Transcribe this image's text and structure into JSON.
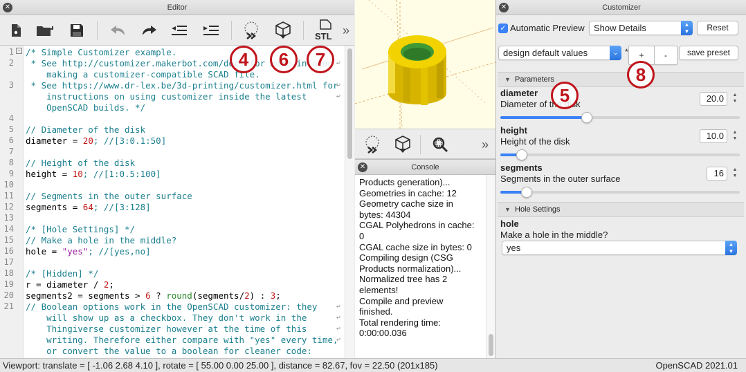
{
  "editor": {
    "title": "Editor",
    "toolbar_more": "»",
    "stl_label": "STL",
    "lines": [
      {
        "n": "1",
        "segs": [
          {
            "t": "/* Simple Customizer example.",
            "c": "#1a7f8e"
          }
        ]
      },
      {
        "n": "2",
        "segs": [
          {
            "t": " * See http://customizer.makerbot.com/docs for more info on",
            "c": "#1a7f8e"
          }
        ]
      },
      {
        "n": "",
        "segs": [
          {
            "t": "    making a customizer-compatible SCAD file.",
            "c": "#1a7f8e"
          }
        ]
      },
      {
        "n": "3",
        "segs": [
          {
            "t": " * See https://www.dr-lex.be/3d-printing/customizer.html for",
            "c": "#1a7f8e"
          }
        ]
      },
      {
        "n": "",
        "segs": [
          {
            "t": "    instructions on using customizer inside the latest",
            "c": "#1a7f8e"
          }
        ]
      },
      {
        "n": "",
        "segs": [
          {
            "t": "    OpenSCAD builds. */",
            "c": "#1a7f8e"
          }
        ]
      },
      {
        "n": "4",
        "segs": []
      },
      {
        "n": "5",
        "segs": [
          {
            "t": "// Diameter of the disk",
            "c": "#1a7f8e"
          }
        ]
      },
      {
        "n": "6",
        "segs": [
          {
            "t": "diameter = ",
            "c": "#000"
          },
          {
            "t": "20",
            "c": "#c01818"
          },
          {
            "t": "; //[3:0.1:50]",
            "c": "#1a7f8e"
          }
        ]
      },
      {
        "n": "7",
        "segs": []
      },
      {
        "n": "8",
        "segs": [
          {
            "t": "// Height of the disk",
            "c": "#1a7f8e"
          }
        ]
      },
      {
        "n": "9",
        "segs": [
          {
            "t": "height = ",
            "c": "#000"
          },
          {
            "t": "10",
            "c": "#c01818"
          },
          {
            "t": "; //[1:0.5:100]",
            "c": "#1a7f8e"
          }
        ]
      },
      {
        "n": "10",
        "segs": []
      },
      {
        "n": "11",
        "segs": [
          {
            "t": "// Segments in the outer surface",
            "c": "#1a7f8e"
          }
        ]
      },
      {
        "n": "12",
        "segs": [
          {
            "t": "segments = ",
            "c": "#000"
          },
          {
            "t": "64",
            "c": "#c01818"
          },
          {
            "t": "; //[3:128]",
            "c": "#1a7f8e"
          }
        ]
      },
      {
        "n": "13",
        "segs": []
      },
      {
        "n": "14",
        "segs": [
          {
            "t": "/* [Hole Settings] */",
            "c": "#1a7f8e"
          }
        ]
      },
      {
        "n": "15",
        "segs": [
          {
            "t": "// Make a hole in the middle?",
            "c": "#1a7f8e"
          }
        ]
      },
      {
        "n": "16",
        "segs": [
          {
            "t": "hole = ",
            "c": "#000"
          },
          {
            "t": "\"yes\"",
            "c": "#9b1fa0"
          },
          {
            "t": "; //[yes,no]",
            "c": "#1a7f8e"
          }
        ]
      },
      {
        "n": "17",
        "segs": []
      },
      {
        "n": "18",
        "segs": [
          {
            "t": "/* [Hidden] */",
            "c": "#1a7f8e"
          }
        ]
      },
      {
        "n": "19",
        "segs": [
          {
            "t": "r = diameter / ",
            "c": "#000"
          },
          {
            "t": "2",
            "c": "#c01818"
          },
          {
            "t": ";",
            "c": "#000"
          }
        ]
      },
      {
        "n": "20",
        "segs": [
          {
            "t": "segments2 = segments > ",
            "c": "#000"
          },
          {
            "t": "6",
            "c": "#c01818"
          },
          {
            "t": " ? ",
            "c": "#000"
          },
          {
            "t": "round",
            "c": "#2a8a2a"
          },
          {
            "t": "(segments/",
            "c": "#000"
          },
          {
            "t": "2",
            "c": "#c01818"
          },
          {
            "t": ") : ",
            "c": "#000"
          },
          {
            "t": "3",
            "c": "#c01818"
          },
          {
            "t": ";",
            "c": "#000"
          }
        ]
      },
      {
        "n": "21",
        "segs": [
          {
            "t": "// Boolean options work in the OpenSCAD customizer: they",
            "c": "#1a7f8e"
          }
        ]
      },
      {
        "n": "",
        "segs": [
          {
            "t": "    will show up as a checkbox. They don't work in the",
            "c": "#1a7f8e"
          }
        ]
      },
      {
        "n": "",
        "segs": [
          {
            "t": "    Thingiverse customizer however at the time of this",
            "c": "#1a7f8e"
          }
        ]
      },
      {
        "n": "",
        "segs": [
          {
            "t": "    writing. Therefore either compare with \"yes\" every time,",
            "c": "#1a7f8e"
          }
        ]
      },
      {
        "n": "",
        "segs": [
          {
            "t": "    or convert the value to a boolean for cleaner code:",
            "c": "#1a7f8e"
          }
        ]
      }
    ]
  },
  "viewport_toolbar_more": "»",
  "console": {
    "title": "Console",
    "lines": [
      "Products generation)...",
      "Geometries in cache: 12",
      "Geometry cache size in",
      "bytes: 44304",
      "CGAL Polyhedrons in cache:",
      "0",
      "CGAL cache size in bytes: 0",
      "Compiling design (CSG",
      "Products normalization)...",
      "Normalized tree has 2",
      "elements!",
      "Compile and preview",
      "finished.",
      "Total rendering time:",
      "0:00:00.036"
    ]
  },
  "customizer": {
    "title": "Customizer",
    "automatic_preview_label": "Automatic Preview",
    "automatic_preview_checked": true,
    "details_select": "Show Details",
    "reset_label": "Reset",
    "preset_select": "design default values",
    "add_preset_label": "+",
    "remove_preset_label": "-",
    "save_preset_label": "save preset",
    "section_parameters": "Parameters",
    "section_hole": "Hole Settings",
    "diameter": {
      "name": "diameter",
      "desc": "Diameter of the disk",
      "value": "20.0",
      "level": 0.36
    },
    "height": {
      "name": "height",
      "desc": "Height of the disk",
      "value": "10.0",
      "level": 0.09
    },
    "segments": {
      "name": "segments",
      "desc": "Segments in the outer surface",
      "value": "16",
      "level": 0.11
    },
    "hole": {
      "name": "hole",
      "desc": "Make a hole in the middle?",
      "value": "yes"
    }
  },
  "status": {
    "left": "Viewport: translate = [ -1.06 2.68 4.10 ], rotate = [ 55.00 0.00 25.00 ], distance = 82.67, fov = 22.50 (201x185)",
    "right": "OpenSCAD 2021.01"
  },
  "callouts": [
    "4",
    "6",
    "7",
    "5",
    "8"
  ],
  "colors": {
    "accent": "#3b82f6",
    "callout": "#c0141b",
    "model": "#f2d200",
    "hole": "#3f9a36",
    "viewport_bg": "#fffde6"
  }
}
